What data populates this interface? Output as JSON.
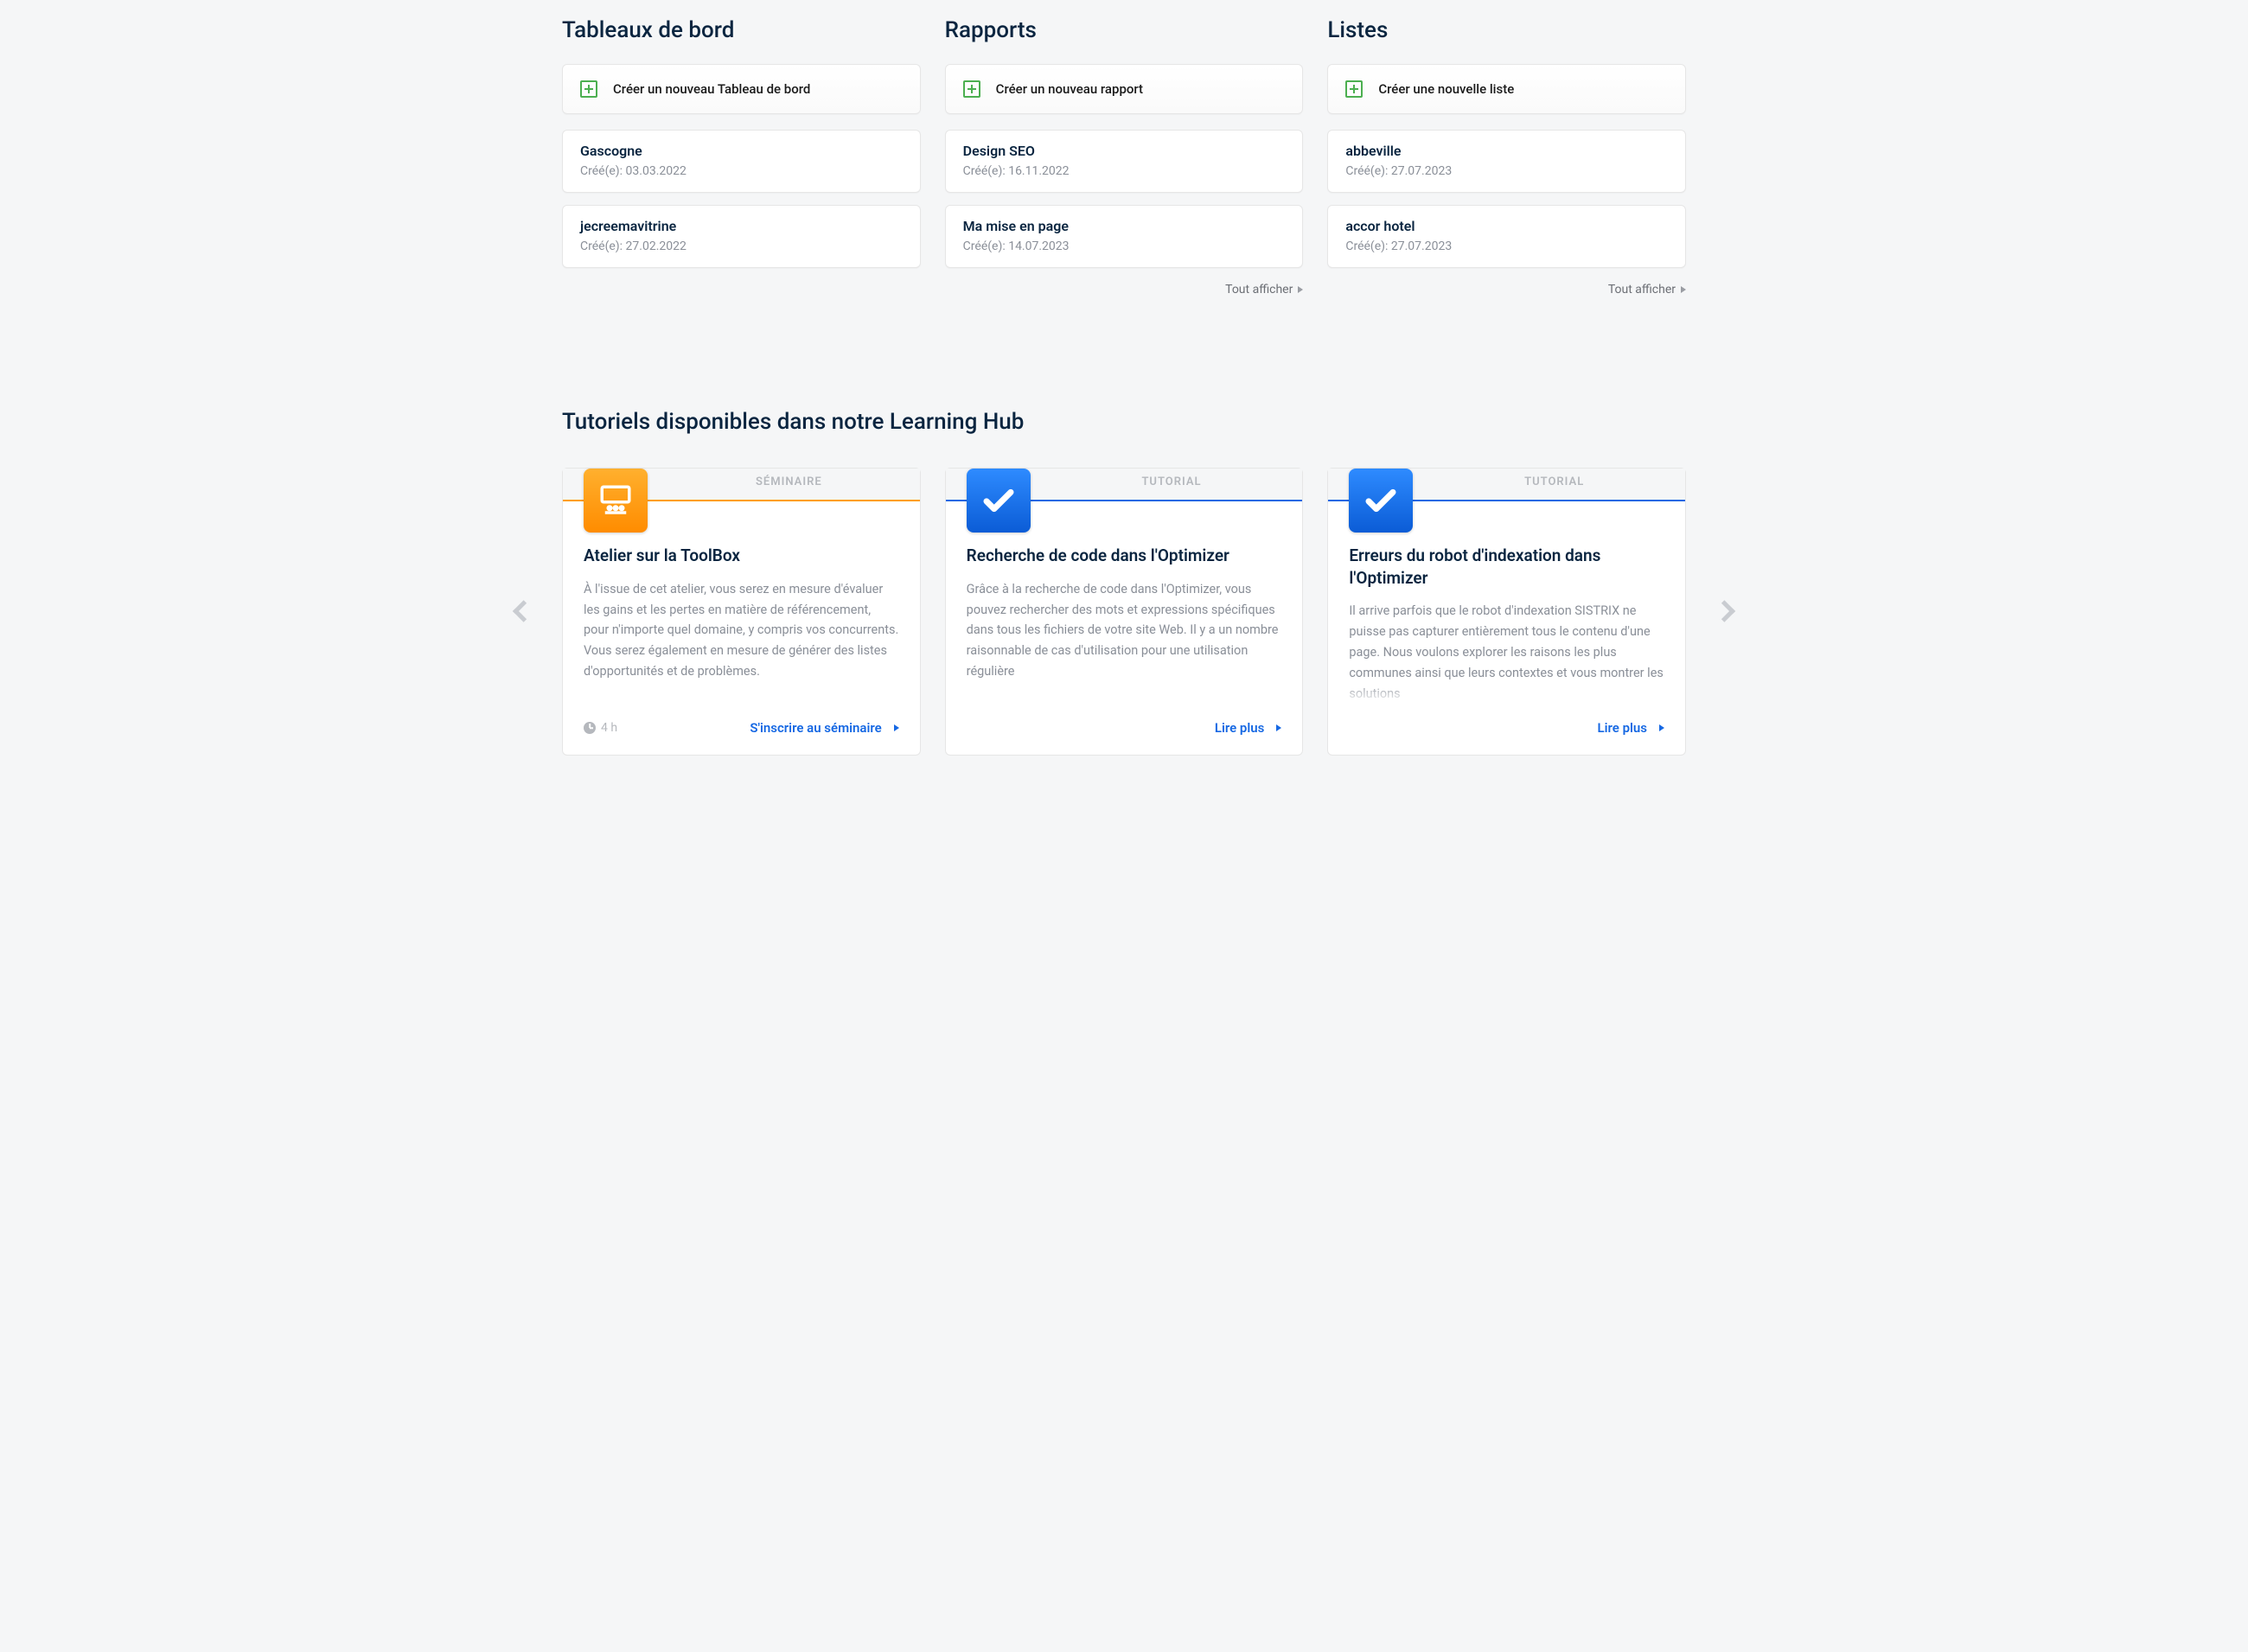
{
  "columns": [
    {
      "title": "Tableaux de bord",
      "create_label": "Créer un nouveau Tableau de bord",
      "items": [
        {
          "name": "Gascogne",
          "meta": "Créé(e): 03.03.2022"
        },
        {
          "name": "jecreemavitrine",
          "meta": "Créé(e): 27.02.2022"
        }
      ],
      "show_all": null
    },
    {
      "title": "Rapports",
      "create_label": "Créer un nouveau rapport",
      "items": [
        {
          "name": "Design SEO",
          "meta": "Créé(e): 16.11.2022"
        },
        {
          "name": "Ma mise en page",
          "meta": "Créé(e): 14.07.2023"
        }
      ],
      "show_all": "Tout afficher"
    },
    {
      "title": "Listes",
      "create_label": "Créer une nouvelle liste",
      "items": [
        {
          "name": "abbeville",
          "meta": "Créé(e): 27.07.2023"
        },
        {
          "name": "accor hotel",
          "meta": "Créé(e): 27.07.2023"
        }
      ],
      "show_all": "Tout afficher"
    }
  ],
  "learning": {
    "title": "Tutoriels disponibles dans notre Learning Hub",
    "cards": [
      {
        "type_label": "SÉMINAIRE",
        "badge": "seminar",
        "accent": "#ff9e00",
        "title": "Atelier sur la ToolBox",
        "desc": "À l'issue de cet atelier, vous serez en mesure d'évaluer les gains et les pertes en matière de référencement, pour n'importe quel domaine, y compris vos concurrents. Vous serez également en mesure de générer des listes d'opportunités et de problèmes.",
        "duration": "4 h",
        "cta": "S'inscrire au séminaire"
      },
      {
        "type_label": "TUTORIAL",
        "badge": "check",
        "accent": "#1668e3",
        "title": "Recherche de code dans l'Optimizer",
        "desc": "Grâce à la recherche de code dans l'Optimizer, vous pouvez rechercher des mots et expressions spécifiques dans tous les fichiers de votre site Web. Il y a un nombre raisonnable de cas d'utilisation pour une utilisation régulière",
        "duration": null,
        "cta": "Lire plus"
      },
      {
        "type_label": "TUTORIAL",
        "badge": "check",
        "accent": "#1668e3",
        "title": "Erreurs du robot d'indexation dans l'Optimizer",
        "desc": "Il arrive parfois que le robot d'indexation SISTRIX ne puisse pas capturer entièrement tous le contenu d'une page. Nous voulons explorer les raisons les plus communes ainsi que leurs contextes et vous montrer les solutions",
        "duration": null,
        "cta": "Lire plus"
      }
    ]
  }
}
